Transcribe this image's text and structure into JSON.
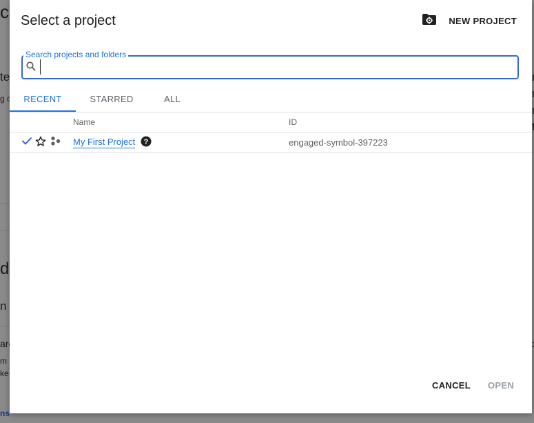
{
  "background": {
    "fragments": [
      "co",
      "te",
      "g c",
      "de",
      "n f",
      "are",
      "m",
      "ke",
      "ns",
      "n",
      "n",
      "n",
      "t",
      "oi"
    ]
  },
  "dialog": {
    "title": "Select a project",
    "new_project_label": "NEW PROJECT",
    "search": {
      "label": "Search projects and folders",
      "value": ""
    },
    "tabs": [
      "RECENT",
      "STARRED",
      "ALL"
    ],
    "active_tab": "RECENT",
    "columns": {
      "name": "Name",
      "id": "ID"
    },
    "rows": [
      {
        "name": "My First Project",
        "id": "engaged-symbol-397223",
        "selected": true
      }
    ],
    "buttons": {
      "cancel": "CANCEL",
      "open": "OPEN"
    }
  },
  "colors": {
    "accent": "#1a73e8",
    "border_focus": "#3367d6",
    "text": "#202124",
    "muted": "#5f6368"
  }
}
